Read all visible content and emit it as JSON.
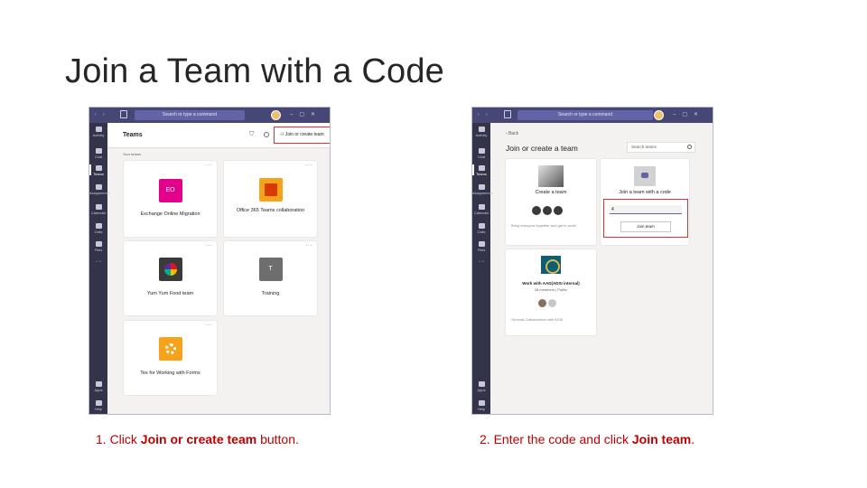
{
  "slide": {
    "title": "Join a Team with a Code",
    "caption_left": {
      "pre": "1. Click ",
      "bold": "Join or create team",
      "post": " button."
    },
    "caption_right": {
      "pre": "2. Enter the code and click ",
      "bold": "Join team",
      "post": "."
    },
    "accent_color": "#d13438",
    "caption_color": "#c00000"
  },
  "app_left": {
    "search_placeholder": "Search or type a command",
    "rail": [
      "Activity",
      "Chat",
      "Teams",
      "Assignments",
      "Calendar",
      "Calls",
      "Files",
      "Apps",
      "Help"
    ],
    "header_title": "Teams",
    "join_button": "Join or create team",
    "section_label": "Your teams",
    "teams": [
      {
        "name": "Exchange Online Migration",
        "initials": "EO",
        "color": "#e3008c"
      },
      {
        "name": "Office 365 Teams collaboration",
        "initials": "",
        "color": "#f7a21b"
      },
      {
        "name": "Yum Yum Food team",
        "initials": "",
        "color": "#3b3a39"
      },
      {
        "name": "Training",
        "initials": "T",
        "color": "#6e6e6e"
      },
      {
        "name": "Tes for Working with Forms",
        "initials": "",
        "color": "#f7a21b"
      }
    ]
  },
  "app_right": {
    "search_placeholder": "Search or type a command",
    "back": "Back",
    "heading": "Join or create a team",
    "search_teams": "Search teams",
    "create_title": "Create a team",
    "create_desc": "Bring everyone together and get to work!",
    "join_title": "Join a team with a code",
    "code_value": "4",
    "join_button": "Join team",
    "work_title": "Work with AAD(ADSI internal)",
    "work_meta": "28 members | Public",
    "work_desc": "General Collaboration with ADSI"
  }
}
